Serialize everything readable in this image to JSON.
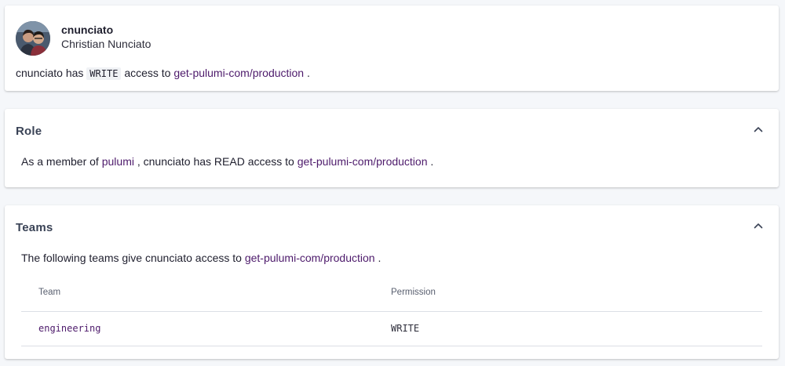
{
  "user": {
    "username": "cnunciato",
    "full_name": "Christian Nunciato",
    "access_prefix": "cnunciato has",
    "access_level": "WRITE",
    "access_middle": "access to",
    "stack": "get-pulumi-com/production",
    "access_suffix": "."
  },
  "role": {
    "title": "Role",
    "text_prefix": "As a member of",
    "org": "pulumi",
    "text_middle": ", cnunciato has READ access to",
    "stack": "get-pulumi-com/production",
    "text_suffix": "."
  },
  "teams": {
    "title": "Teams",
    "text_prefix": "The following teams give cnunciato access to",
    "stack": "get-pulumi-com/production",
    "text_suffix": ".",
    "columns": [
      "Team",
      "Permission"
    ],
    "rows": [
      {
        "team": "engineering",
        "permission": "WRITE"
      }
    ]
  },
  "icons": {
    "collapse": "chevron-up-icon",
    "avatar": "user-avatar"
  },
  "colors": {
    "link": "#4d1a6b",
    "section_title": "#3a4356",
    "background": "#f5f7fa"
  }
}
